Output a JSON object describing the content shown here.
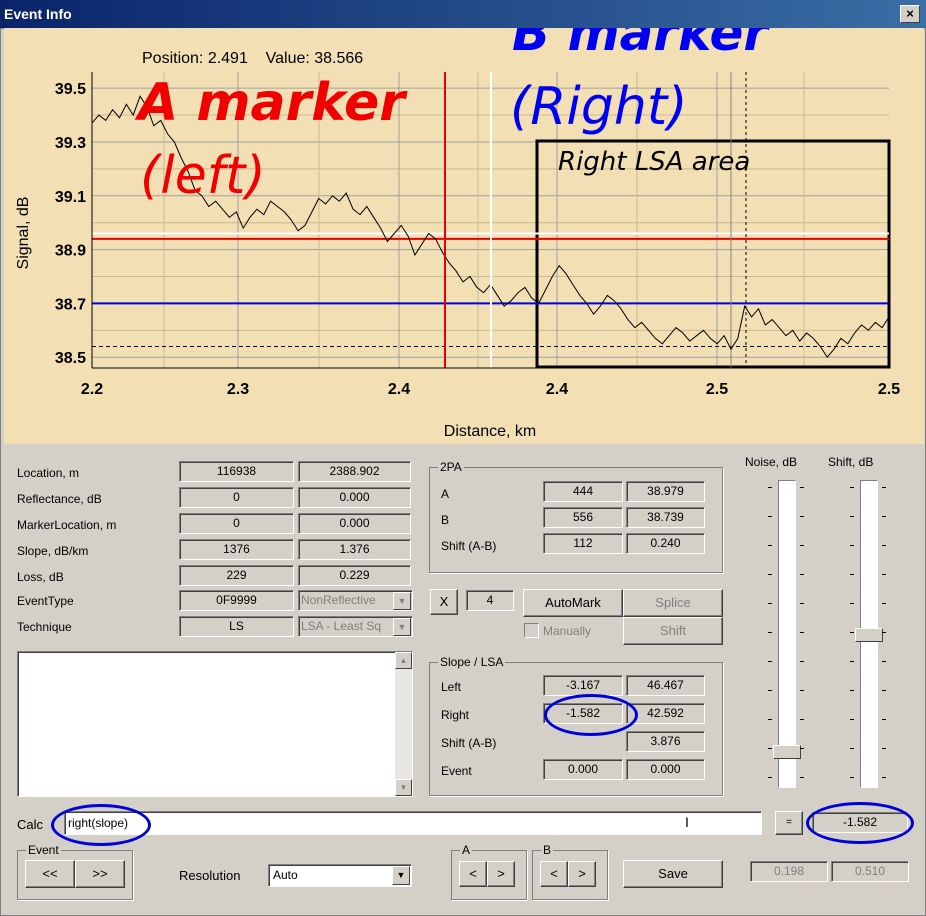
{
  "window": {
    "title": "Event Info",
    "close": "×"
  },
  "chart_data": {
    "type": "line",
    "ylabel": "Signal, dB",
    "xlabel": "Distance, km",
    "readout": "Position: 2.491    Value: 38.566",
    "yticks": [
      "39.5",
      "39.3",
      "39.1",
      "38.9",
      "38.7",
      "38.5"
    ],
    "xticks": [
      "2.2",
      "2.3",
      "2.4",
      "2.4",
      "2.5",
      "2.5"
    ],
    "annotations": {
      "a_marker": "A marker",
      "a_left": "(left)",
      "b_marker": "B marker",
      "b_right": "(Right)",
      "right_lsa": "Right LSA area"
    },
    "series": [
      {
        "values": [
          39.37,
          39.4,
          39.38,
          39.42,
          39.39,
          39.44,
          39.4,
          39.47,
          39.43,
          39.36,
          39.38,
          39.33,
          39.3,
          39.24,
          39.19,
          39.12,
          39.1,
          39.06,
          39.08,
          39.05,
          39.02,
          39.04,
          38.98,
          39.02,
          39.05,
          39.03,
          39.08,
          39.06,
          39.04,
          39.01,
          38.97,
          38.99,
          39.04,
          39.09,
          39.07,
          39.1,
          39.08,
          39.11,
          39.05,
          39.03,
          39.06,
          39.02,
          38.98,
          38.93,
          38.96,
          38.99,
          38.95,
          38.88,
          38.92,
          38.96,
          38.94,
          38.89,
          38.85,
          38.82,
          38.78,
          38.8,
          38.76,
          38.74,
          38.77,
          38.73,
          38.69,
          38.71,
          38.74,
          38.76,
          38.72,
          38.7,
          38.75,
          38.8,
          38.84,
          38.81,
          38.77,
          38.73,
          38.7,
          38.66,
          38.69,
          38.73,
          38.71,
          38.68,
          38.64,
          38.61,
          38.63,
          38.6,
          38.57,
          38.55,
          38.58,
          38.61,
          38.59,
          38.56,
          38.58,
          38.6,
          38.57,
          38.55,
          38.58,
          38.53,
          38.57,
          38.69,
          38.65,
          38.68,
          38.62,
          38.64,
          38.61,
          38.58,
          38.6,
          38.56,
          38.59,
          38.57,
          38.54,
          38.5,
          38.53,
          38.57,
          38.55,
          38.59,
          38.62,
          38.6,
          38.63,
          38.61,
          38.65
        ]
      }
    ],
    "ylim": [
      38.46,
      39.56
    ],
    "hlines": {
      "red": 38.94,
      "blue": 38.7,
      "white": 38.96,
      "dashed": 38.54
    },
    "colors": {
      "background": "#f2dfb4",
      "red": "#e80000",
      "blue": "#0000e0",
      "trace": "#000000"
    }
  },
  "left": {
    "rows": [
      {
        "label": "Location, m",
        "v1": "116938",
        "v2": "2388.902"
      },
      {
        "label": "Reflectance, dB",
        "v1": "0",
        "v2": "0.000"
      },
      {
        "label": "MarkerLocation, m",
        "v1": "0",
        "v2": "0.000"
      },
      {
        "label": "Slope, dB/km",
        "v1": "1376",
        "v2": "1.376"
      },
      {
        "label": "Loss, dB",
        "v1": "229",
        "v2": "0.229"
      }
    ],
    "eventtype": {
      "label": "EventType",
      "v1": "0F9999",
      "v2": "NonReflective"
    },
    "technique": {
      "label": "Technique",
      "v1": "LS",
      "v2": "LSA - Least Sq"
    }
  },
  "twopa": {
    "title": "2PA",
    "rows": [
      {
        "label": "A",
        "v1": "444",
        "v2": "38.979"
      },
      {
        "label": "B",
        "v1": "556",
        "v2": "38.739"
      },
      {
        "label": "Shift (A-B)",
        "v1": "112",
        "v2": "0.240"
      }
    ]
  },
  "controls": {
    "x": "X",
    "count": "4",
    "automark": "AutoMark",
    "splice": "Splice",
    "manually": "Manually",
    "shift": "Shift"
  },
  "slope": {
    "title": "Slope / LSA",
    "left": {
      "label": "Left",
      "v1": "-3.167",
      "v2": "46.467"
    },
    "right": {
      "label": "Right",
      "v1": "-1.582",
      "v2": "42.592"
    },
    "shift": {
      "label": "Shift (A-B)",
      "v2": "3.876"
    },
    "event": {
      "label": "Event",
      "v1": "0.000",
      "v2": "0.000"
    }
  },
  "sliders": {
    "noise": "Noise, dB",
    "shift": "Shift, dB"
  },
  "calc": {
    "label": "Calc",
    "value": "right(slope)",
    "equals": "=",
    "result": "-1.582"
  },
  "bottom": {
    "event": "Event",
    "prev": "<<",
    "next": ">>",
    "resolution": "Resolution",
    "resolution_value": "Auto",
    "a": "A",
    "b": "B",
    "lt": "<",
    "gt": ">",
    "save": "Save",
    "val1": "0.198",
    "val2": "0.510"
  }
}
